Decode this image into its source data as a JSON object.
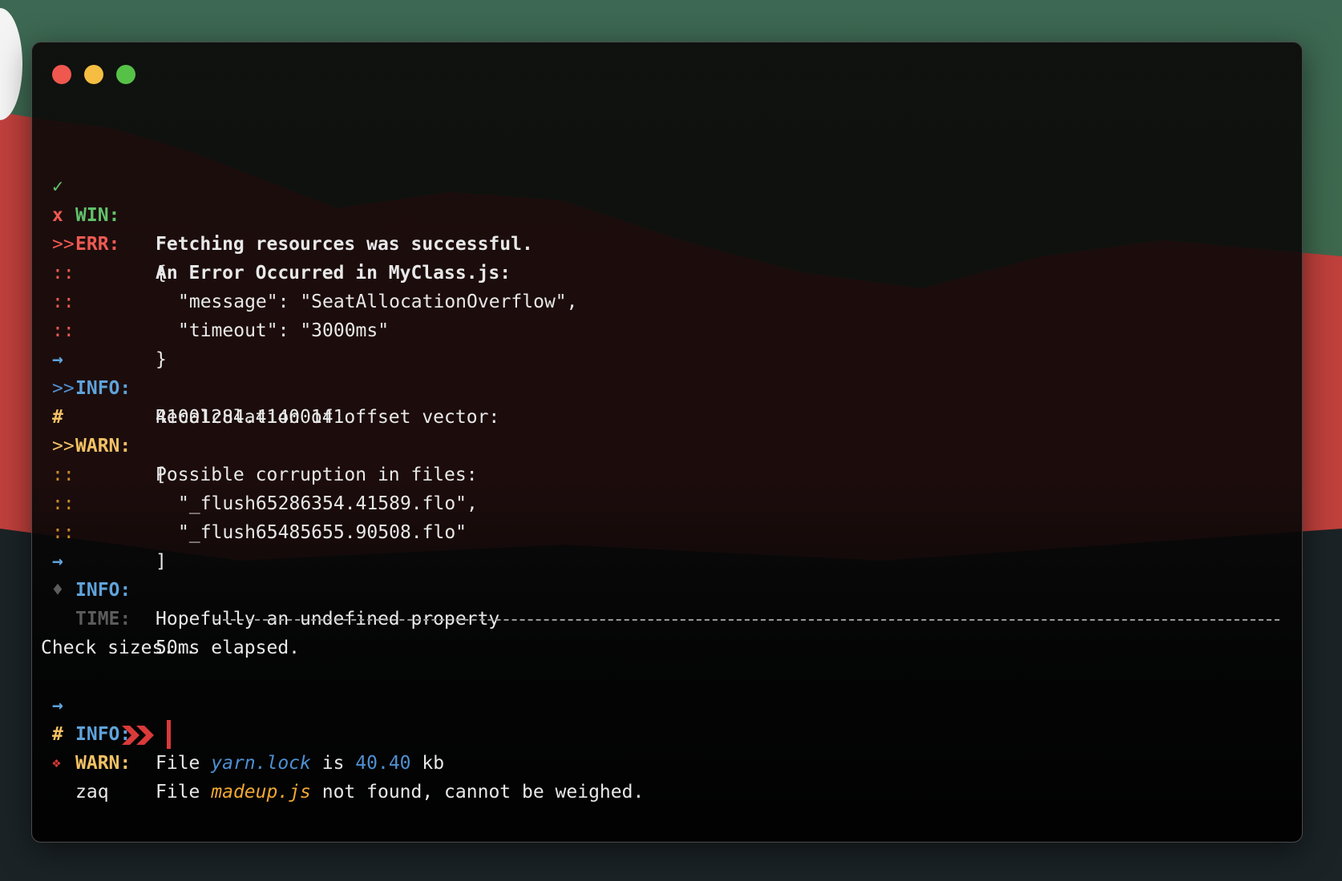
{
  "colors": {
    "win": "#61c26b",
    "err": "#ef5a52",
    "info": "#5fa3db",
    "warn": "#f2c164",
    "time": "#5c5c5c",
    "cursor": "#d93a3a"
  },
  "log": {
    "win": {
      "icon": "✓",
      "label": "WIN:",
      "message": "Fetching resources was successful."
    },
    "err": {
      "icon": "x",
      "label": "ERR:",
      "message": "An Error Occurred in MyClass.js:"
    },
    "err_lines": [
      {
        "marker": ">>",
        "text": "{"
      },
      {
        "marker": "::",
        "text": "\"message\": \"SeatAllocationOverflow\","
      },
      {
        "marker": "::",
        "text": "\"timeout\": \"3000ms\""
      },
      {
        "marker": "::",
        "text": "}"
      }
    ],
    "info1": {
      "icon": "→",
      "label": "INFO:",
      "message": "Recalculation of offset vector:"
    },
    "info1_lines": [
      {
        "marker": ">>",
        "text": "41001284.41400141"
      }
    ],
    "warn1": {
      "icon": "#",
      "label": "WARN:",
      "message": "Possible corruption in files:"
    },
    "warn1_lines": [
      {
        "marker": ">>",
        "text": "["
      },
      {
        "marker": "::",
        "text": "\"_flush65286354.41589.flo\","
      },
      {
        "marker": "::",
        "text": "\"_flush65485655.90508.flo\""
      },
      {
        "marker": "::",
        "text": "]"
      }
    ],
    "info2": {
      "icon": "→",
      "label": "INFO:",
      "message": "Hopefully an undefined property"
    },
    "time": {
      "icon": "♦",
      "label": "TIME:",
      "message": "50ms elapsed."
    }
  },
  "check": {
    "title": "Check sizes..."
  },
  "sizes": {
    "info": {
      "icon": "→",
      "label": "INFO:",
      "prefix": "File",
      "file": "yarn.lock",
      "is": "is",
      "size": "40.40",
      "unit": "kb"
    },
    "warn": {
      "icon": "#",
      "label": "WARN:",
      "prefix": "File",
      "file": "madeup.js",
      "suffix": "not found, cannot be weighed."
    }
  },
  "prompt": {
    "icon": "❖",
    "user": "zaq",
    "icon_name": "double-chevron-right-icon"
  }
}
